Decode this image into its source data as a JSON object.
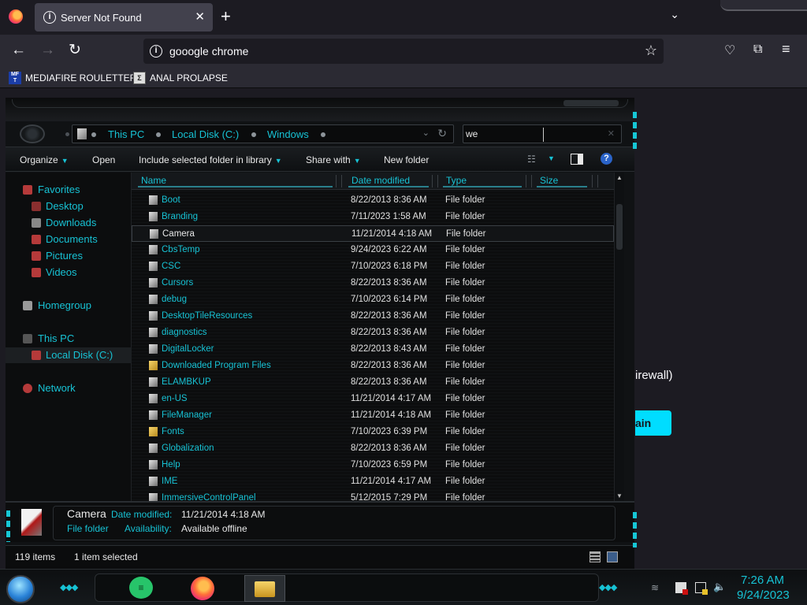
{
  "browser": {
    "tab": {
      "title": "Server Not Found",
      "close": "✕"
    },
    "new_tab": "+",
    "tab_list": "⌄",
    "nav": {
      "back": "←",
      "forward": "→",
      "reload": "↻"
    },
    "url": "gooogle chrome",
    "bookmarks": [
      {
        "label": "MEDIAFIRE ROULETTER",
        "icon": "mediafire-icon"
      },
      {
        "label": "ANAL PROLAPSE",
        "icon": "bookmark-page-icon"
      }
    ],
    "page": {
      "partial_text": "irewall)",
      "button_partial": "ain"
    },
    "colors": {
      "accent": "#00ddff",
      "bg": "#1c1b22",
      "toolbar": "#2b2a33"
    }
  },
  "explorer": {
    "breadcrumbs": [
      "This PC",
      "Local Disk (C:)",
      "Windows"
    ],
    "search_value": "we",
    "toolbar": {
      "organize": "Organize",
      "open": "Open",
      "include": "Include selected folder in library",
      "share": "Share with",
      "new_folder": "New folder"
    },
    "nav": {
      "favorites": "Favorites",
      "desktop": "Desktop",
      "downloads": "Downloads",
      "documents": "Documents",
      "pictures": "Pictures",
      "videos": "Videos",
      "homegroup": "Homegroup",
      "this_pc": "This PC",
      "local_disk": "Local Disk (C:)",
      "network": "Network"
    },
    "columns": {
      "name": "Name",
      "date": "Date modified",
      "type": "Type",
      "size": "Size"
    },
    "files": [
      {
        "name": "Boot",
        "date": "8/22/2013 8:36 AM",
        "type": "File folder",
        "icon": "folder-icon"
      },
      {
        "name": "Branding",
        "date": "7/11/2023 1:58 AM",
        "type": "File folder",
        "icon": "folder-icon"
      },
      {
        "name": "Camera",
        "date": "11/21/2014 4:18 AM",
        "type": "File folder",
        "icon": "folder-icon",
        "selected": true
      },
      {
        "name": "CbsTemp",
        "date": "9/24/2023 6:22 AM",
        "type": "File folder",
        "icon": "folder-icon"
      },
      {
        "name": "CSC",
        "date": "7/10/2023 6:18 PM",
        "type": "File folder",
        "icon": "folder-icon"
      },
      {
        "name": "Cursors",
        "date": "8/22/2013 8:36 AM",
        "type": "File folder",
        "icon": "folder-icon"
      },
      {
        "name": "debug",
        "date": "7/10/2023 6:14 PM",
        "type": "File folder",
        "icon": "folder-icon"
      },
      {
        "name": "DesktopTileResources",
        "date": "8/22/2013 8:36 AM",
        "type": "File folder",
        "icon": "folder-icon"
      },
      {
        "name": "diagnostics",
        "date": "8/22/2013 8:36 AM",
        "type": "File folder",
        "icon": "folder-icon"
      },
      {
        "name": "DigitalLocker",
        "date": "8/22/2013 8:43 AM",
        "type": "File folder",
        "icon": "folder-icon"
      },
      {
        "name": "Downloaded Program Files",
        "date": "8/22/2013 8:36 AM",
        "type": "File folder",
        "icon": "special-folder-icon"
      },
      {
        "name": "ELAMBKUP",
        "date": "8/22/2013 8:36 AM",
        "type": "File folder",
        "icon": "folder-icon"
      },
      {
        "name": "en-US",
        "date": "11/21/2014 4:17 AM",
        "type": "File folder",
        "icon": "folder-icon"
      },
      {
        "name": "FileManager",
        "date": "11/21/2014 4:18 AM",
        "type": "File folder",
        "icon": "folder-icon"
      },
      {
        "name": "Fonts",
        "date": "7/10/2023 6:39 PM",
        "type": "File folder",
        "icon": "special-folder-icon"
      },
      {
        "name": "Globalization",
        "date": "8/22/2013 8:36 AM",
        "type": "File folder",
        "icon": "folder-icon"
      },
      {
        "name": "Help",
        "date": "7/10/2023 6:59 PM",
        "type": "File folder",
        "icon": "folder-icon"
      },
      {
        "name": "IME",
        "date": "11/21/2014 4:17 AM",
        "type": "File folder",
        "icon": "folder-icon"
      },
      {
        "name": "ImmersiveControlPanel",
        "date": "5/12/2015 7:29 PM",
        "type": "File folder",
        "icon": "folder-icon"
      }
    ],
    "details": {
      "name": "Camera",
      "type": "File folder",
      "date_label": "Date modified:",
      "date_value": "11/21/2014 4:18 AM",
      "avail_label": "Availability:",
      "avail_value": "Available offline"
    },
    "status": {
      "items": "119 items",
      "selected": "1 item selected"
    },
    "colors": {
      "accent": "#17c2d4",
      "text": "#e8e8e8",
      "bg": "#0c0d0e"
    }
  },
  "taskbar": {
    "time": "7:26 AM",
    "date": "9/24/2023",
    "apps": [
      "sticky-notes-icon",
      "firefox-icon",
      "file-explorer-icon"
    ]
  }
}
